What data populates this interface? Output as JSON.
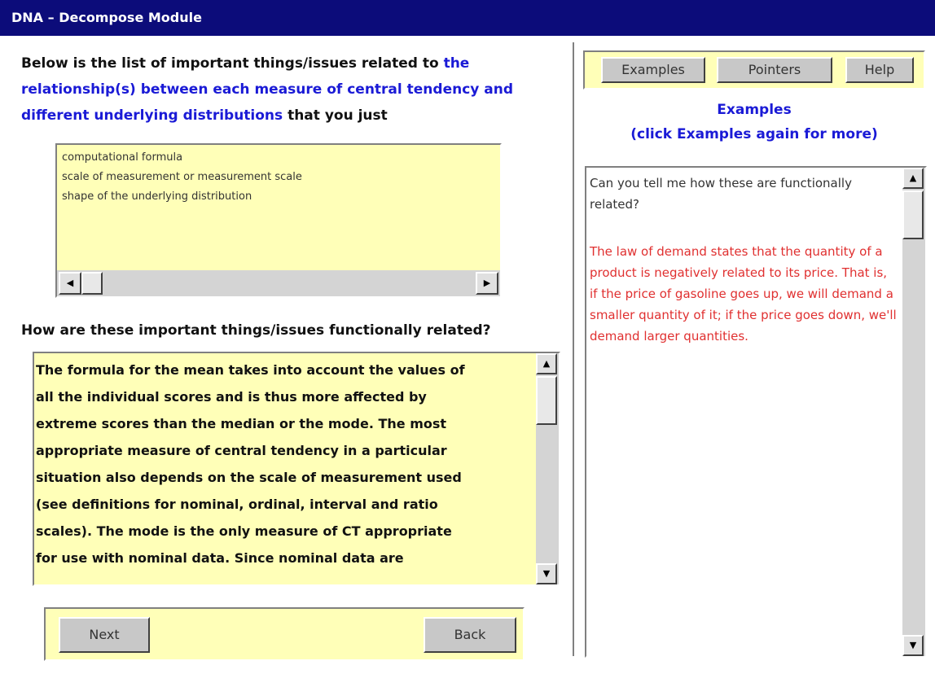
{
  "window": {
    "title": "DNA – Decompose Module"
  },
  "intro": {
    "text_before": "Below is the list of important things/issues related to ",
    "highlight": "the relationship(s) between each measure of central tendency and different underlying distributions",
    "text_after": " that you just"
  },
  "issues_list": {
    "items": [
      "computational formula",
      "scale of measurement or measurement scale",
      "shape of the underlying distribution"
    ],
    "scroll_left_icon": "◀",
    "scroll_right_icon": "▶"
  },
  "question": {
    "label": "How are these important things/issues functionally related?"
  },
  "answer": {
    "text": "The formula for the mean takes into account the values of\nall the individual  scores and is thus more affected by\nextreme scores than the median or the mode.  The most\nappropriate measure of  central tendency in a particular\nsituation also depends on the scale of measurement used\n(see definitions for nominal, ordinal, interval and ratio\nscales).  The mode is the only measure of CT appropriate\nfor use with nominal data. Since nominal data are",
    "scroll_up_icon": "▲",
    "scroll_down_icon": "▼"
  },
  "nav": {
    "next_label": "Next",
    "back_label": "Back"
  },
  "toolbar": {
    "examples_label": "Examples",
    "pointers_label": "Pointers",
    "help_label": "Help"
  },
  "examples": {
    "title": "Examples",
    "subtitle": "(click Examples again for more)",
    "prompt": "Can you tell me how these are functionally related?",
    "body": "The law of demand states that the quantity of a product is negatively related to its price. That is, if the price of gasoline goes up, we will demand a smaller quantity of it; if the price goes down, we'll demand larger quantities."
  },
  "colors": {
    "titlebar": "#0c0c7a",
    "highlight_blue": "#1a1ad6",
    "panel_yellow": "#ffffb8",
    "example_red": "#e03030"
  }
}
